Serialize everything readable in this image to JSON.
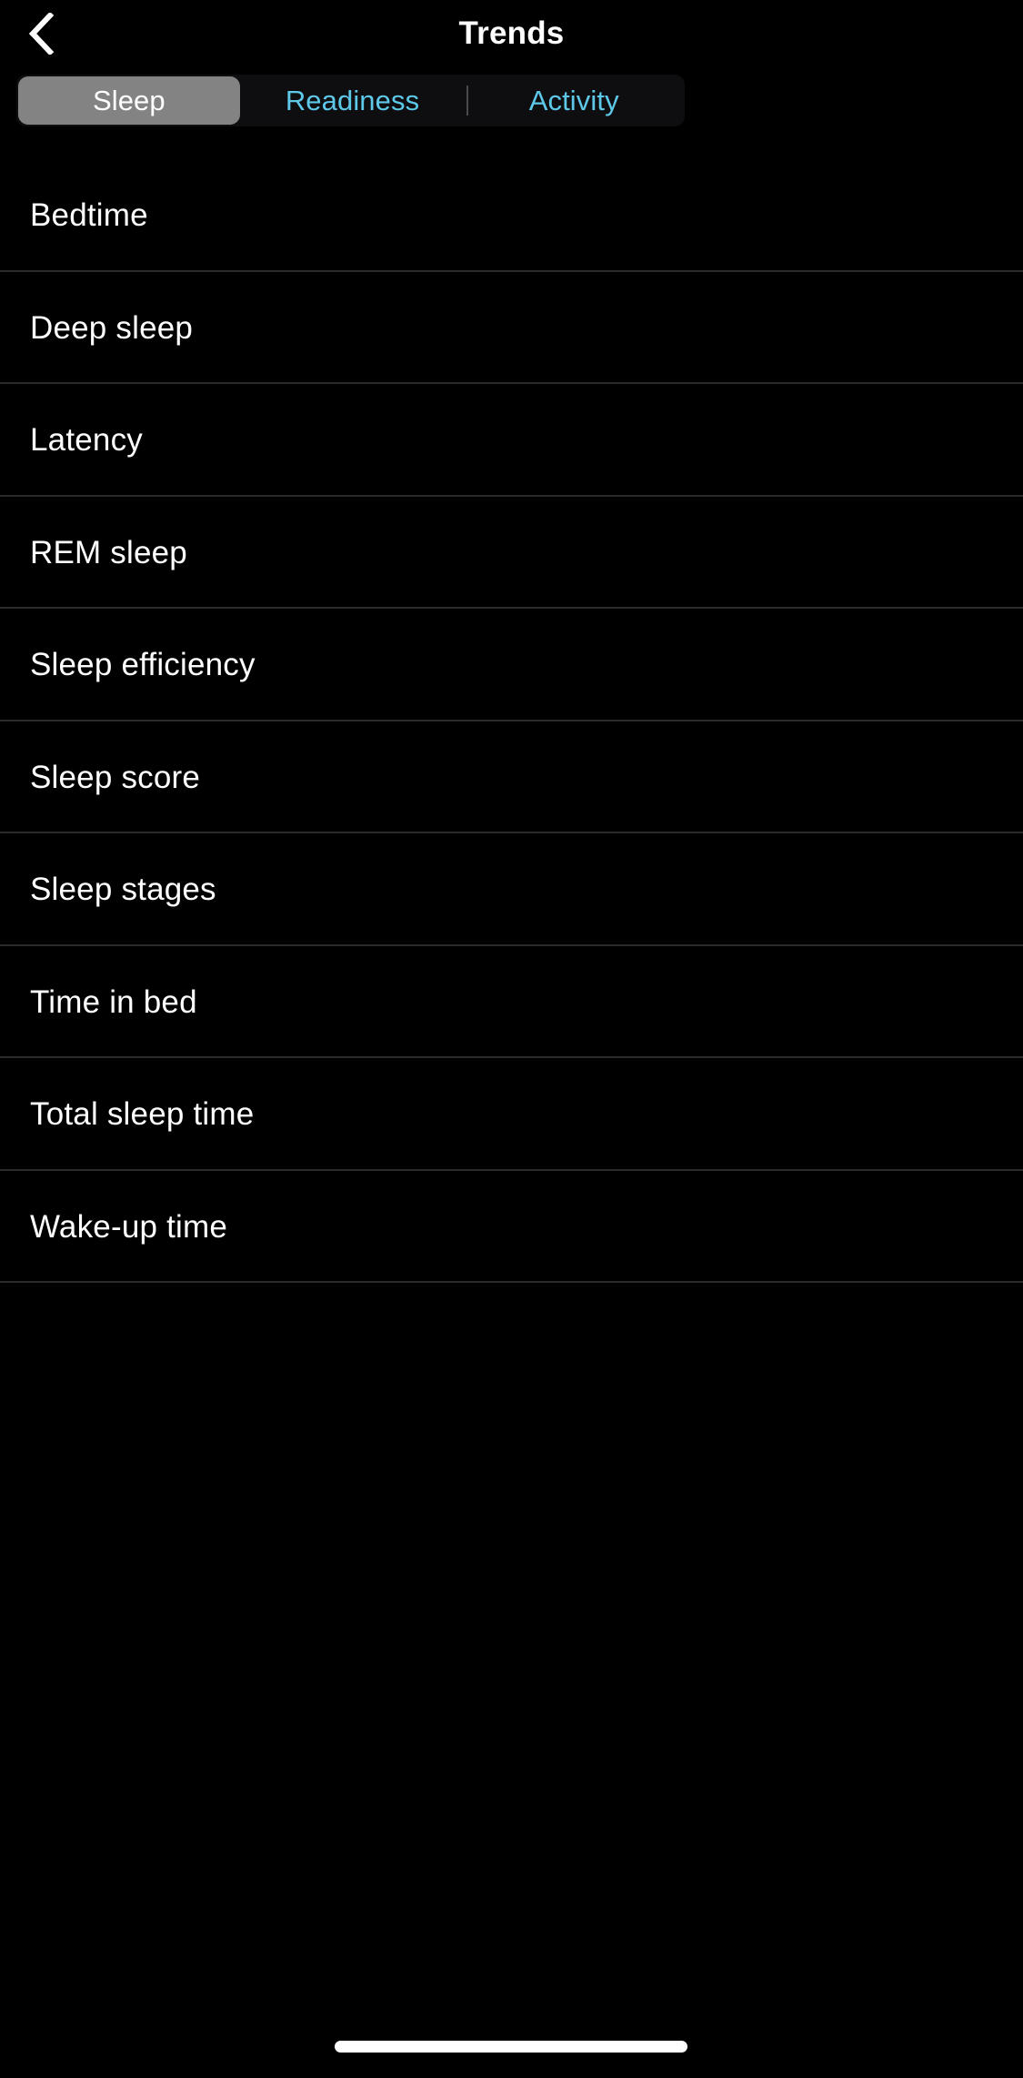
{
  "header": {
    "title": "Trends",
    "back_icon": "chevron-left-icon"
  },
  "tabs": {
    "items": [
      {
        "label": "Sleep",
        "selected": true
      },
      {
        "label": "Readiness",
        "selected": false
      },
      {
        "label": "Activity",
        "selected": false
      }
    ],
    "selected_label": "Sleep",
    "selected_bg": "#838383",
    "selected_text_color": "#ffffff",
    "unselected_text_color": "#5ec8e8",
    "container_bg": "#0e0e11",
    "divider_color": "#4a4a4a"
  },
  "list": {
    "items": [
      {
        "label": "Bedtime"
      },
      {
        "label": "Deep sleep"
      },
      {
        "label": "Latency"
      },
      {
        "label": "REM sleep"
      },
      {
        "label": "Sleep efficiency"
      },
      {
        "label": "Sleep score"
      },
      {
        "label": "Sleep stages"
      },
      {
        "label": "Time in bed"
      },
      {
        "label": "Total sleep time"
      },
      {
        "label": "Wake-up time"
      }
    ],
    "separator_color": "#2b2b2b",
    "text_color": "#ffffff"
  },
  "system": {
    "background": "#000000",
    "home_indicator_color": "#ffffff"
  }
}
